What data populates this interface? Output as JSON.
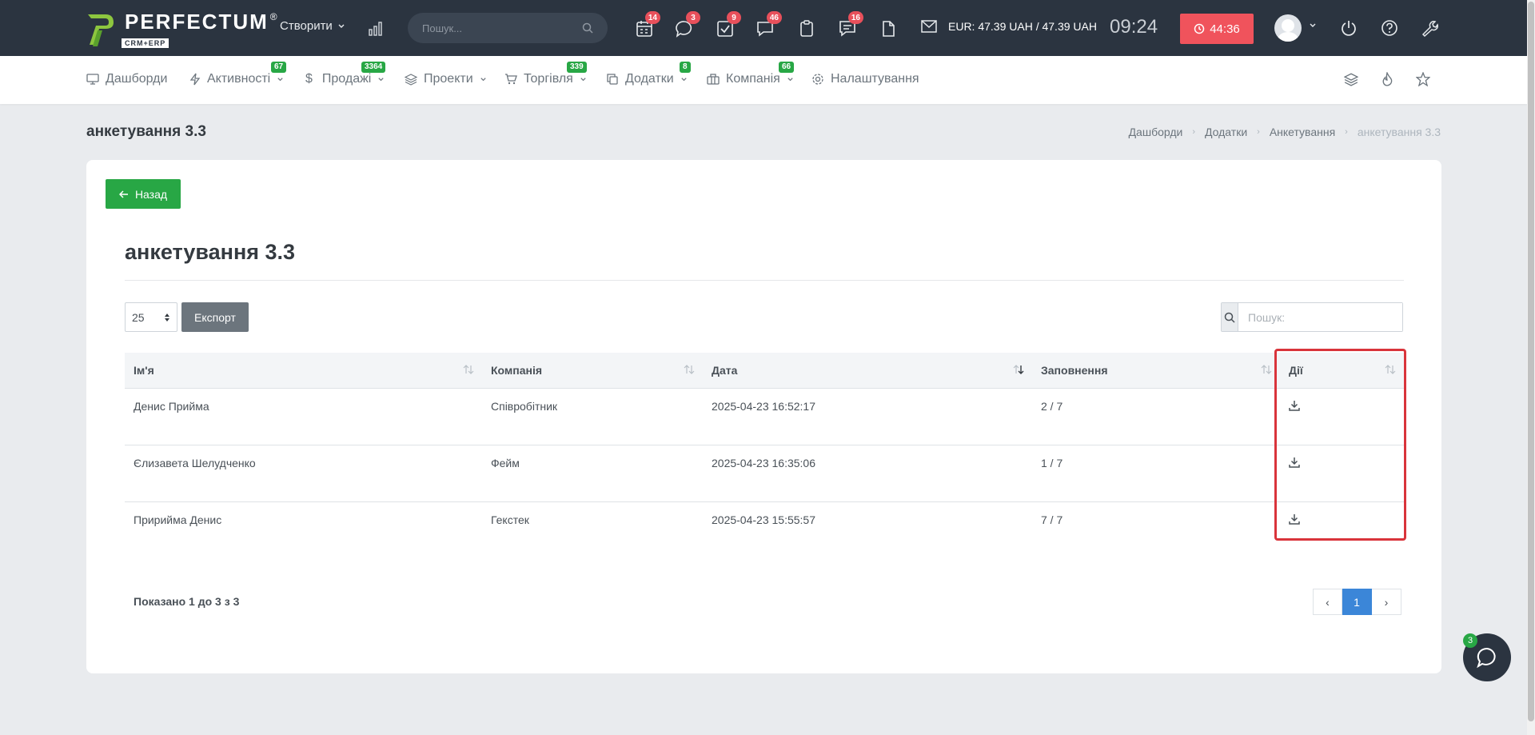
{
  "topbar": {
    "logo_text": "PERFECTUM",
    "logo_reg": "®",
    "logo_sub": "CRM+ERP",
    "create_label": "Створити",
    "search_placeholder": "Пошук...",
    "icons": [
      {
        "name": "calendar-icon",
        "badge": "14"
      },
      {
        "name": "chat-icon",
        "badge": "3"
      },
      {
        "name": "tasks-icon",
        "badge": "9"
      },
      {
        "name": "messages-icon",
        "badge": "46"
      },
      {
        "name": "clipboard-icon",
        "badge": ""
      },
      {
        "name": "comments-icon",
        "badge": "16"
      },
      {
        "name": "document-icon",
        "badge": ""
      }
    ],
    "currency": "EUR: 47.39 UAH / 47.39 UAH",
    "clock": "09:24",
    "timer": "44:36",
    "badge_color": "#e8505b",
    "timer_color": "#f0535c"
  },
  "nav": {
    "items": [
      {
        "label": "Дашборди",
        "icon": "monitor-icon",
        "badge": ""
      },
      {
        "label": "Активності",
        "icon": "bolt-icon",
        "badge": "67"
      },
      {
        "label": "Продажі",
        "icon": "dollar-icon",
        "badge": "3364"
      },
      {
        "label": "Проекти",
        "icon": "layers-icon",
        "badge": ""
      },
      {
        "label": "Торгівля",
        "icon": "cart-icon",
        "badge": "339"
      },
      {
        "label": "Додатки",
        "icon": "copy-icon",
        "badge": "8"
      },
      {
        "label": "Компанія",
        "icon": "briefcase-icon",
        "badge": "66"
      },
      {
        "label": "Налаштування",
        "icon": "gear-icon",
        "badge": ""
      }
    ],
    "badge_color": "#28a745"
  },
  "page": {
    "title": "анкетування 3.3",
    "breadcrumb": [
      "Дашборди",
      "Додатки",
      "Анкетування",
      "анкетування 3.3"
    ]
  },
  "card": {
    "back_label": "Назад",
    "title": "анкетування 3.3",
    "page_size": "25",
    "export_label": "Експорт",
    "search_placeholder": "Пошук:",
    "columns": [
      "Ім'я",
      "Компанія",
      "Дата",
      "Заповнення",
      "Дії"
    ],
    "rows": [
      {
        "name": "Денис Прийма",
        "company": "Співробітник",
        "date": "2025-04-23 16:52:17",
        "fill": "2 / 7"
      },
      {
        "name": "Єлизавета Шелудченко",
        "company": "Фейм",
        "date": "2025-04-23 16:35:06",
        "fill": "1 / 7"
      },
      {
        "name": "Пририйма Денис",
        "company": "Гекстек",
        "date": "2025-04-23 15:55:57",
        "fill": "7 / 7"
      }
    ],
    "pager_info": "Показано 1 до 3 з 3",
    "pager_prev": "‹",
    "pager_current": "1",
    "pager_next": "›",
    "accent_color": "#3b86d8",
    "back_color": "#28a745",
    "highlight_color": "#d9343b"
  },
  "chat": {
    "badge": "3"
  }
}
